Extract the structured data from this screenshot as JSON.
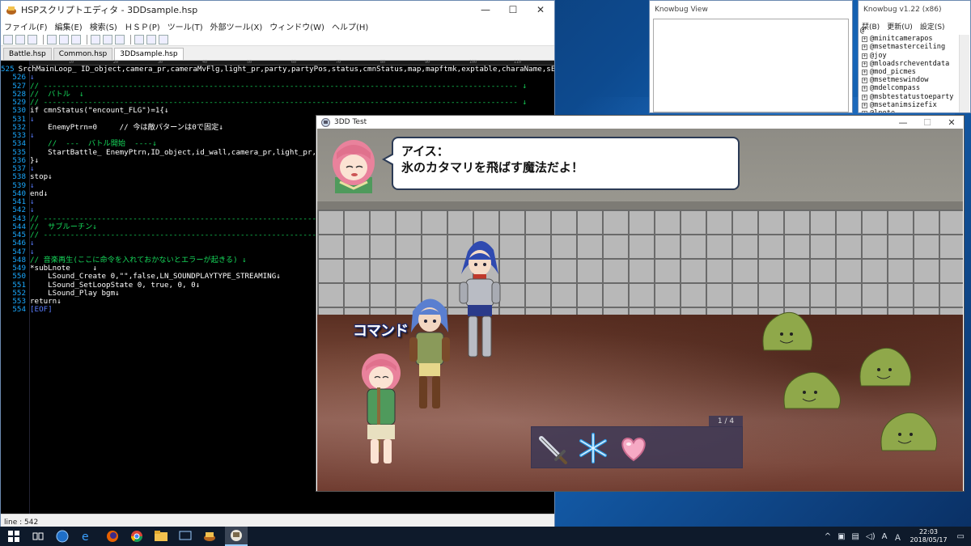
{
  "editor": {
    "title": "HSPスクリプトエディタ - 3DDsample.hsp",
    "menu": [
      "ファイル(F)",
      "編集(E)",
      "検索(S)",
      "ＨＳＰ(P)",
      "ツール(T)",
      "外部ツール(X)",
      "ウィンドウ(W)",
      "ヘルプ(H)"
    ],
    "tabs": [
      "Battle.hsp",
      "Common.hsp",
      "3DDsample.hsp"
    ],
    "active_tab": "3DDsample.hsp",
    "ruler_marks": [
      "10",
      "20",
      "30",
      "40",
      "50",
      "60",
      "70",
      "80",
      "90",
      "100",
      "110",
      "120",
      "130"
    ],
    "code": [
      {
        "n": "525",
        "t": "SrchMainLoop_ ID_object,camera_pr,cameraMvFlg,light_pr,party,partyPos,status,cmnStatus,map,mapftmk,exptable,charaName,sEvtStart",
        "k": "code"
      },
      {
        "n": "526",
        "t": "↓",
        "k": "eol"
      },
      {
        "n": "527",
        "t": "// ---------------------------------------------------------------------------------------------------------- ↓",
        "k": "cmt"
      },
      {
        "n": "528",
        "t": "//  バトル  ↓",
        "k": "cmt"
      },
      {
        "n": "529",
        "t": "// ---------------------------------------------------------------------------------------------------------- ↓",
        "k": "cmt"
      },
      {
        "n": "530",
        "t": "if cmnStatus(\"encount_FLG\")=1{↓",
        "k": "code"
      },
      {
        "n": "531",
        "t": "↓",
        "k": "eol"
      },
      {
        "n": "532",
        "t": "    EnemyPtrn=0     // 今は敵パターンは0で固定↓",
        "k": "code"
      },
      {
        "n": "533",
        "t": "↓",
        "k": "eol"
      },
      {
        "n": "534",
        "t": "    //  ---  バトル開始  ----↓",
        "k": "cmt"
      },
      {
        "n": "535",
        "t": "    StartBattle_ EnemyPtrn,ID_object,id_wall,camera_pr,light_pr,skill,p",
        "k": "code"
      },
      {
        "n": "536",
        "t": "}↓",
        "k": "code"
      },
      {
        "n": "537",
        "t": "↓",
        "k": "eol"
      },
      {
        "n": "538",
        "t": "stop↓",
        "k": "code"
      },
      {
        "n": "539",
        "t": "↓",
        "k": "eol"
      },
      {
        "n": "540",
        "t": "end↓",
        "k": "code"
      },
      {
        "n": "541",
        "t": "↓",
        "k": "eol"
      },
      {
        "n": "542",
        "t": "↓",
        "k": "eol"
      },
      {
        "n": "543",
        "t": "// -------------------------------------------------------------------------------",
        "k": "cmt"
      },
      {
        "n": "544",
        "t": "//  サブルーチン↓",
        "k": "cmt"
      },
      {
        "n": "545",
        "t": "// -------------------------------------------------------------------------------",
        "k": "cmt"
      },
      {
        "n": "546",
        "t": "↓",
        "k": "eol"
      },
      {
        "n": "547",
        "t": "↓",
        "k": "eol"
      },
      {
        "n": "548",
        "t": "// 音楽再生(ここに命令を入れておかないとエラーが起きる) ↓",
        "k": "cmt"
      },
      {
        "n": "549",
        "t": "*subLnote     ↓",
        "k": "code"
      },
      {
        "n": "550",
        "t": "    LSound_Create 0,\"\",false,LN_SOUNDPLAYTYPE_STREAMING↓",
        "k": "code"
      },
      {
        "n": "551",
        "t": "    LSound_SetLoopState 0, true, 0, 0↓",
        "k": "code"
      },
      {
        "n": "552",
        "t": "    LSound_Play bgm↓",
        "k": "code"
      },
      {
        "n": "553",
        "t": "return↓",
        "k": "code"
      },
      {
        "n": "554",
        "t": "[EOF]",
        "k": "eol"
      }
    ],
    "status": "line : 542"
  },
  "knowbug_view": {
    "title": "Knowbug View"
  },
  "knowbug": {
    "title": "Knowbug v1.22 (x86)",
    "menu": [
      "栞(B)",
      "更新(U)",
      "設定(S)"
    ],
    "root": "@",
    "items": [
      "@minitcamerapos",
      "@msetmasterceiling",
      "@joy",
      "@mloadsrcheventdata",
      "@mod_picmes",
      "@msetmeswindow",
      "@mdelcompass",
      "@msbtestatustoeparty",
      "@msetanimsizefix",
      "@lnote"
    ]
  },
  "game": {
    "title": "3DD Test",
    "speaker": "アイス：",
    "message": "氷のカタマリを飛ばす魔法だよ！",
    "command_label": "コマンド",
    "skill_counter": "1 / 4",
    "skills": [
      "sword-icon",
      "snowflake-icon",
      "heart-icon"
    ]
  },
  "taskbar": {
    "time": "22:03",
    "date": "2018/05/17",
    "ime": "A",
    "colors": {
      "accent": "#0078d7"
    }
  }
}
